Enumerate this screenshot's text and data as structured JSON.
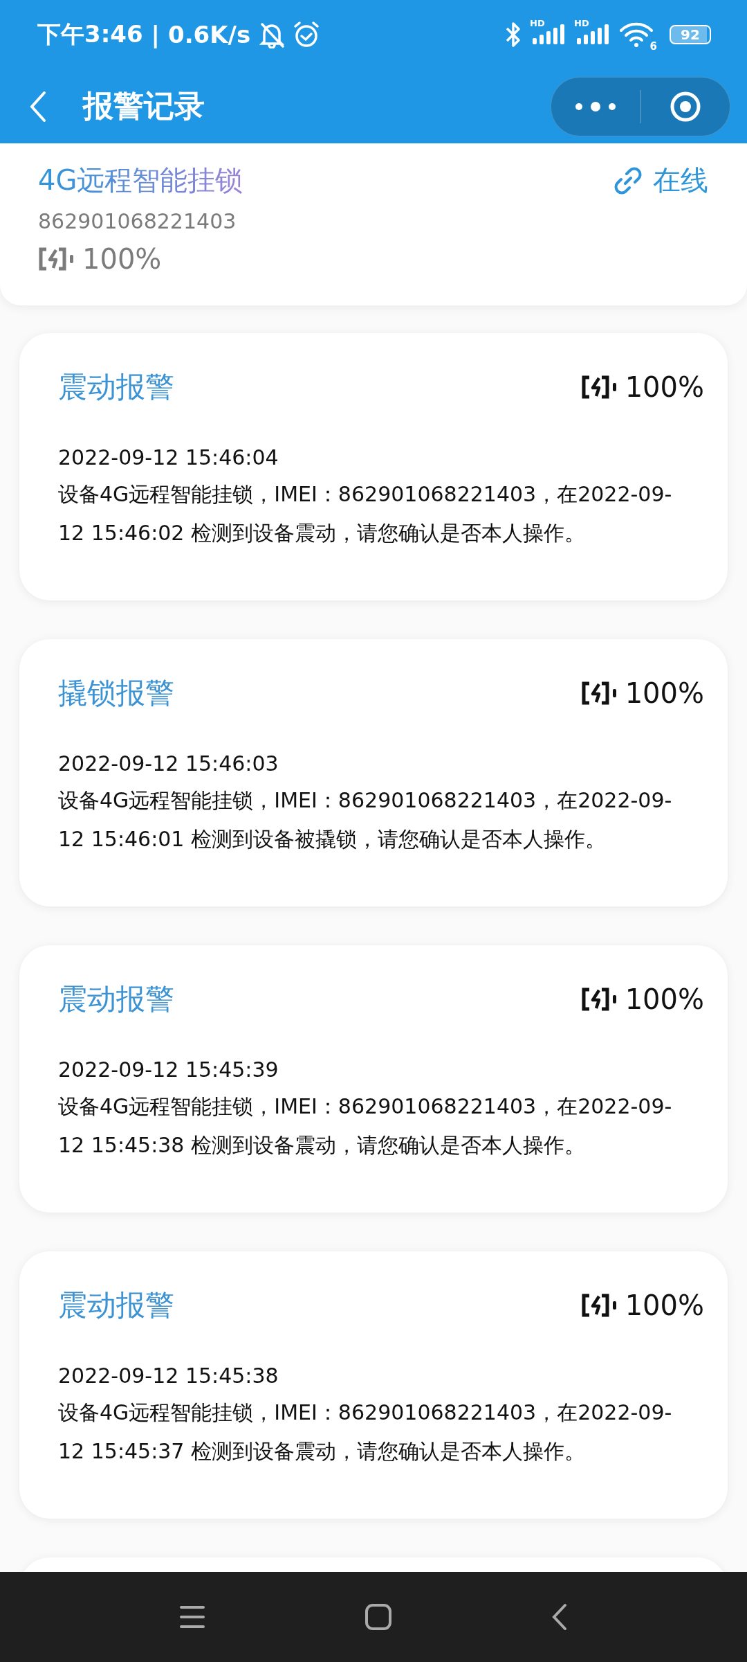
{
  "status_bar": {
    "time": "下午3:46",
    "separator": "|",
    "speed": "0.6K/s",
    "signals": [
      {
        "label": "HD"
      },
      {
        "label": "HD"
      }
    ],
    "wifi_label": "6",
    "battery": "92"
  },
  "header": {
    "title": "报警记录"
  },
  "device": {
    "name": "4G远程智能挂锁",
    "imei": "862901068221403",
    "battery": "100%",
    "status": "在线"
  },
  "alerts": [
    {
      "title": "震动报警",
      "battery": "100%",
      "time": "2022-09-12 15:46:04",
      "message": "设备4G远程智能挂锁，IMEI：862901068221403，在2022-09-12 15:46:02 检测到设备震动，请您确认是否本人操作。"
    },
    {
      "title": "撬锁报警",
      "battery": "100%",
      "time": "2022-09-12 15:46:03",
      "message": "设备4G远程智能挂锁，IMEI：862901068221403，在2022-09-12 15:46:01 检测到设备被撬锁，请您确认是否本人操作。"
    },
    {
      "title": "震动报警",
      "battery": "100%",
      "time": "2022-09-12 15:45:39",
      "message": "设备4G远程智能挂锁，IMEI：862901068221403，在2022-09-12 15:45:38 检测到设备震动，请您确认是否本人操作。"
    },
    {
      "title": "震动报警",
      "battery": "100%",
      "time": "2022-09-12 15:45:38",
      "message": "设备4G远程智能挂锁，IMEI：862901068221403，在2022-09-12 15:45:37 检测到设备震动，请您确认是否本人操作。"
    }
  ]
}
